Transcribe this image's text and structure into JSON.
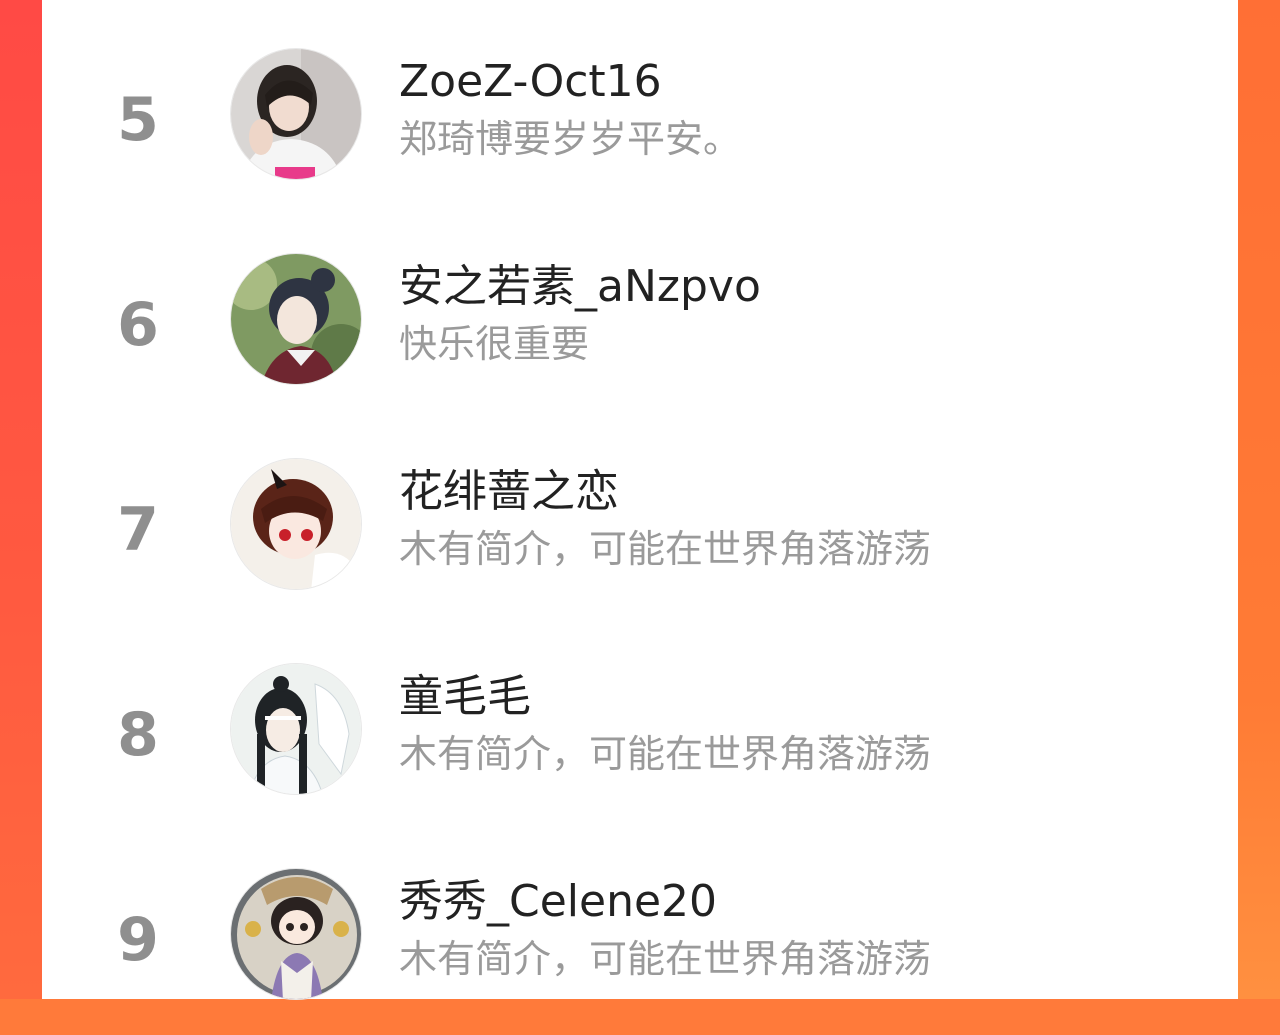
{
  "colors": {
    "rank": "#8f8f8f",
    "name": "#222222",
    "bio": "#9a9a9a",
    "frame_left": "#ff4a45",
    "frame_right": "#ff7b35"
  },
  "ranking_list": {
    "items": [
      {
        "rank": "5",
        "name": "ZoeZ-Oct16",
        "bio": "郑琦博要岁岁平安。",
        "avatar_icon": "avatar-photo-girl"
      },
      {
        "rank": "6",
        "name": "安之若素_aNzpvo",
        "bio": "快乐很重要",
        "avatar_icon": "avatar-anime-green"
      },
      {
        "rank": "7",
        "name": "花绯蔷之恋",
        "bio": "木有简介，可能在世界角落游荡",
        "avatar_icon": "avatar-anime-red-eyes"
      },
      {
        "rank": "8",
        "name": "童毛毛",
        "bio": "木有简介，可能在世界角落游荡",
        "avatar_icon": "avatar-anime-white-robe"
      },
      {
        "rank": "9",
        "name": "秀秀_Celene20",
        "bio": "木有简介，可能在世界角落游荡",
        "avatar_icon": "avatar-anime-chibi"
      }
    ]
  }
}
